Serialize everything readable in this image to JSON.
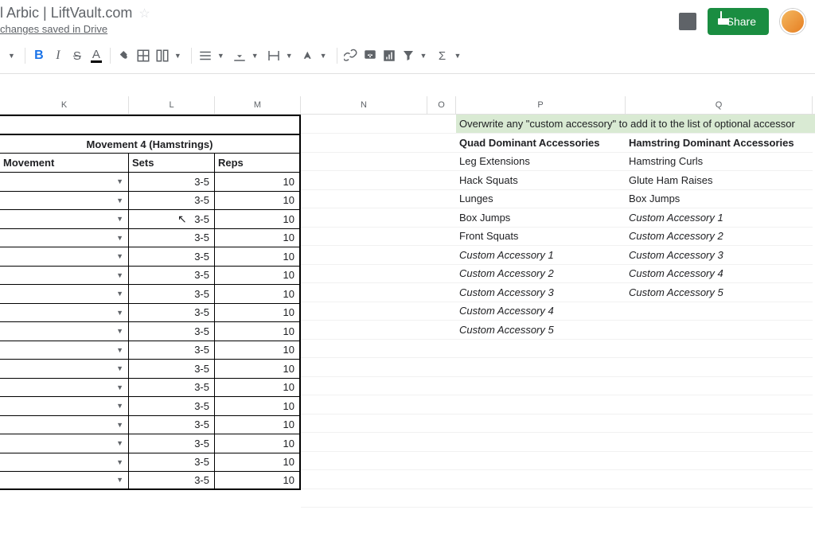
{
  "header": {
    "title": "l Arbic | LiftVault.com",
    "saved": "changes saved in Drive",
    "share": "Share"
  },
  "columns": {
    "k": "K",
    "l": "L",
    "m": "M",
    "n": "N",
    "o": "O",
    "p": "P",
    "q": "Q"
  },
  "section": {
    "title": "Movement 4 (Hamstrings)",
    "movement": "Movement",
    "sets": "Sets",
    "reps": "Reps"
  },
  "rows": [
    {
      "sets": "3-5",
      "reps": "10"
    },
    {
      "sets": "3-5",
      "reps": "10"
    },
    {
      "sets": "3-5",
      "reps": "10"
    },
    {
      "sets": "3-5",
      "reps": "10"
    },
    {
      "sets": "3-5",
      "reps": "10"
    },
    {
      "sets": "3-5",
      "reps": "10"
    },
    {
      "sets": "3-5",
      "reps": "10"
    },
    {
      "sets": "3-5",
      "reps": "10"
    },
    {
      "sets": "3-5",
      "reps": "10"
    },
    {
      "sets": "3-5",
      "reps": "10"
    },
    {
      "sets": "3-5",
      "reps": "10"
    },
    {
      "sets": "3-5",
      "reps": "10"
    },
    {
      "sets": "3-5",
      "reps": "10"
    },
    {
      "sets": "3-5",
      "reps": "10"
    },
    {
      "sets": "3-5",
      "reps": "10"
    },
    {
      "sets": "3-5",
      "reps": "10"
    },
    {
      "sets": "3-5",
      "reps": "10"
    }
  ],
  "info": "Overwrite any \"custom accessory\" to add it to the list of optional accessor",
  "accessories": {
    "quad_header": "Quad Dominant Accessories",
    "ham_header": "Hamstring Dominant Accessories",
    "quad": [
      "Leg Extensions",
      "Hack Squats",
      "Lunges",
      "Box Jumps",
      "Front Squats",
      "Custom Accessory 1",
      "Custom Accessory 2",
      "Custom Accessory 3",
      "Custom Accessory 4",
      "Custom Accessory 5"
    ],
    "ham": [
      "Hamstring Curls",
      "Glute Ham Raises",
      "Box Jumps",
      "Custom Accessory 1",
      "Custom Accessory 2",
      "Custom Accessory 3",
      "Custom Accessory 4",
      "Custom Accessory 5",
      "",
      ""
    ]
  }
}
